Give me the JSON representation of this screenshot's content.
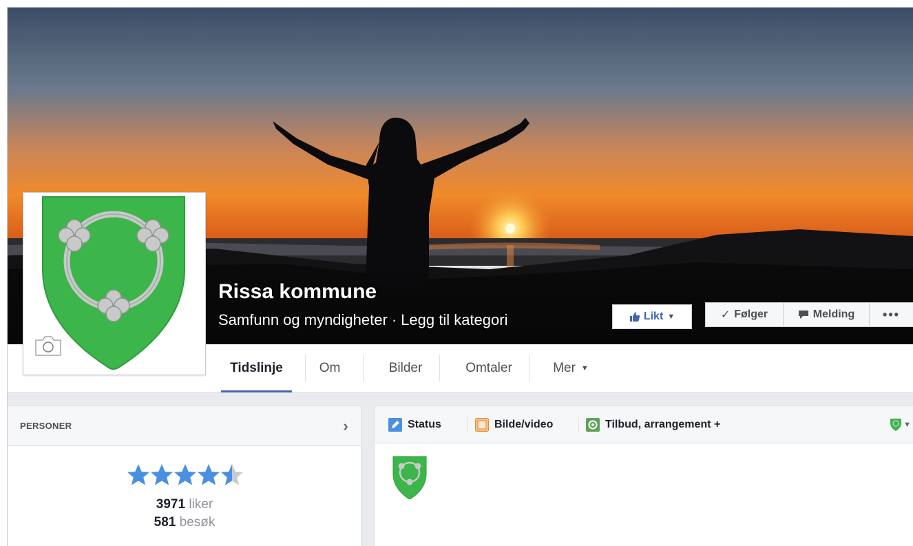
{
  "page": {
    "name": "Rissa kommune",
    "category": "Samfunn og myndigheter",
    "separator": "·",
    "add_category": "Legg til kategori"
  },
  "actions": {
    "liked_label": "Likt",
    "following_label": "Følger",
    "message_label": "Melding",
    "more_label": "•••"
  },
  "nav": {
    "tabs": [
      {
        "label": "Tidslinje",
        "active": true
      },
      {
        "label": "Om",
        "active": false
      },
      {
        "label": "Bilder",
        "active": false
      },
      {
        "label": "Omtaler",
        "active": false
      },
      {
        "label": "Mer",
        "active": false
      }
    ]
  },
  "persons": {
    "heading": "PERSONER",
    "rating": 4.5,
    "rating_max": 5,
    "likes_count": "3971",
    "likes_label": "liker",
    "visits_count": "581",
    "visits_label": "besøk"
  },
  "composer": {
    "tabs": [
      {
        "label": "Status",
        "icon": "pencil-icon"
      },
      {
        "label": "Bilde/video",
        "icon": "photo-icon"
      },
      {
        "label": "Tilbud, arrangement +",
        "icon": "offer-icon"
      }
    ]
  },
  "colors": {
    "accent": "#4267b2",
    "shield_green": "#3cb54a",
    "star_blue": "#4a90e2"
  }
}
